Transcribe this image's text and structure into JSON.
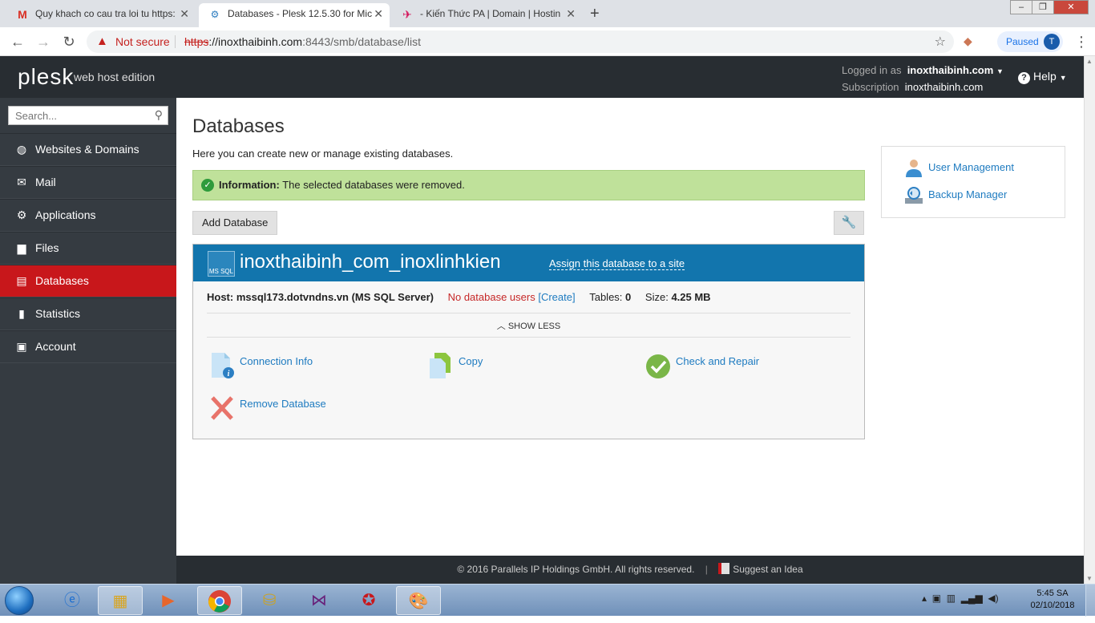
{
  "browser": {
    "tabs": [
      {
        "label": "Quy khach co cau tra loi tu https:",
        "icon": "gmail-icon"
      },
      {
        "label": "Databases - Plesk 12.5.30 for Mic",
        "icon": "plesk-tab-icon"
      },
      {
        "label": "- Kiến Thức PA | Domain | Hostin",
        "icon": "pa-tab-icon"
      }
    ],
    "not_secure": "Not secure",
    "url_scheme": "https",
    "url_host": "://inoxthaibinh.com",
    "url_rest": ":8443/smb/database/list",
    "paused_label": "Paused",
    "avatar_letter": "T"
  },
  "header": {
    "logo": "plesk",
    "logo_sub": "web host edition",
    "logged_in_label": "Logged in as",
    "logged_in_value": "inoxthaibinh.com",
    "subscription_label": "Subscription",
    "subscription_value": "inoxthaibinh.com",
    "help_label": "Help"
  },
  "sidebar": {
    "search_placeholder": "Search...",
    "items": [
      {
        "label": "Websites & Domains",
        "icon": "globe-icon"
      },
      {
        "label": "Mail",
        "icon": "envelope-icon"
      },
      {
        "label": "Applications",
        "icon": "gear-icon"
      },
      {
        "label": "Files",
        "icon": "file-icon"
      },
      {
        "label": "Databases",
        "icon": "database-icon",
        "active": true
      },
      {
        "label": "Statistics",
        "icon": "bar-chart-icon"
      },
      {
        "label": "Account",
        "icon": "id-card-icon"
      }
    ]
  },
  "main": {
    "title": "Databases",
    "description": "Here you can create new or manage existing databases.",
    "info_label": "Information:",
    "info_text": "The selected databases were removed.",
    "add_button": "Add Database",
    "database": {
      "icon_label": "MS SQL",
      "name": "inoxthaibinh_com_inoxlinhkien",
      "assign_link": "Assign this database to a site",
      "host_label": "Host:",
      "host_value": "mssql173.dotvndns.vn (MS SQL Server)",
      "users_text": "No database users",
      "create_link": "[Create]",
      "tables_label": "Tables:",
      "tables_value": "0",
      "size_label": "Size:",
      "size_value": "4.25 MB",
      "show_less": "SHOW LESS",
      "actions": {
        "connection_info": "Connection Info",
        "copy": "Copy",
        "check_repair": "Check and Repair",
        "remove": "Remove Database"
      }
    },
    "side_links": {
      "user_management": "User Management",
      "backup_manager": "Backup Manager"
    }
  },
  "footer": {
    "copyright": "© 2016 Parallels IP Holdings GmbH. All rights reserved.",
    "separator": "|",
    "suggest": "Suggest an Idea"
  },
  "taskbar": {
    "time": "5:45 SA",
    "date": "02/10/2018"
  }
}
